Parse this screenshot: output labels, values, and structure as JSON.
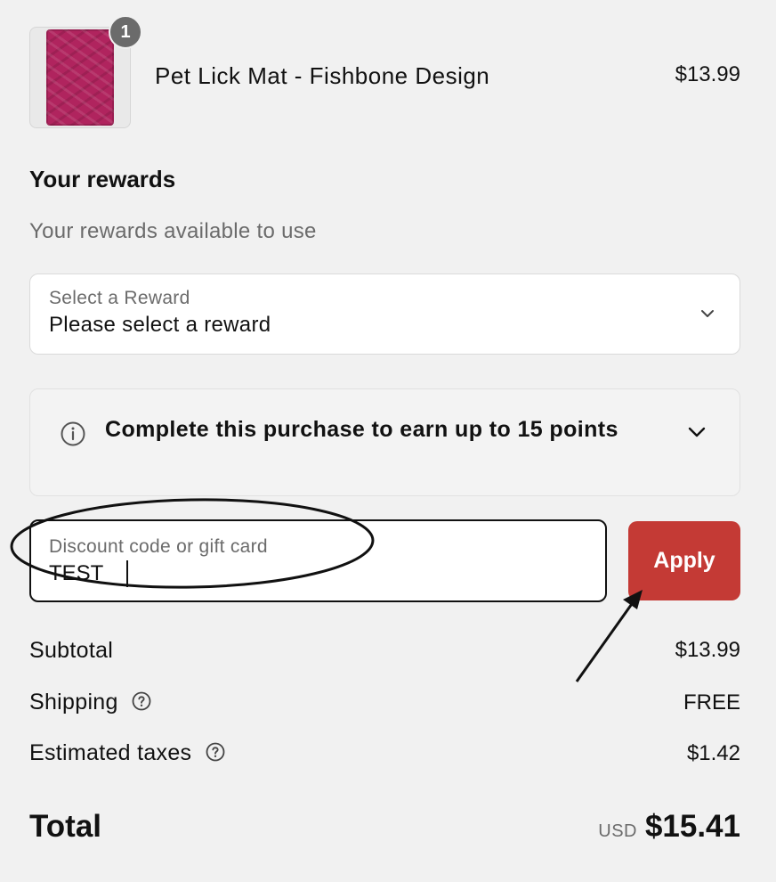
{
  "line_item": {
    "quantity": "1",
    "name": "Pet Lick Mat - Fishbone Design",
    "price": "$13.99",
    "image_icon": "lick-mat-thumbnail"
  },
  "rewards": {
    "heading": "Your rewards",
    "subtext": "Your rewards available to use",
    "select": {
      "label": "Select a Reward",
      "value": "Please select a reward"
    },
    "points_message": "Complete this purchase to earn up to 15 points"
  },
  "discount": {
    "placeholder": "Discount code or gift card",
    "value": "TEST",
    "apply_label": "Apply",
    "apply_color": "#c43a35"
  },
  "summary": {
    "subtotal_label": "Subtotal",
    "subtotal_value": "$13.99",
    "shipping_label": "Shipping",
    "shipping_value": "FREE",
    "taxes_label": "Estimated taxes",
    "taxes_value": "$1.42",
    "total_label": "Total",
    "currency": "USD",
    "total_value": "$15.41"
  }
}
